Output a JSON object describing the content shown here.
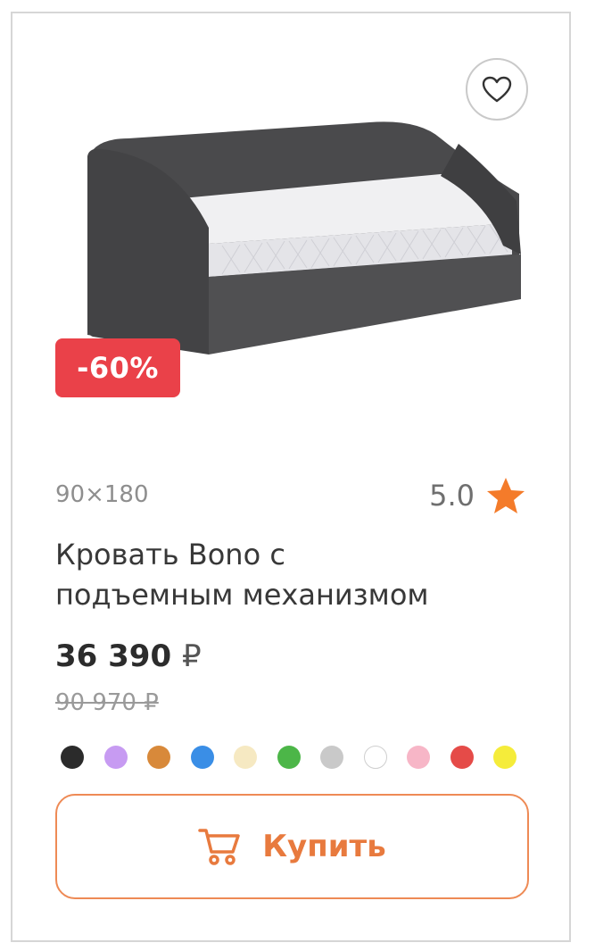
{
  "product": {
    "discount_badge": "-60%",
    "size": "90×180",
    "rating": "5.0",
    "title_line1": "Кровать Bono с",
    "title_line2": "подъемным механизмом",
    "price": "36 390",
    "currency": "₽",
    "old_price": "90 970 ₽",
    "buy_label": "Купить"
  },
  "icons": {
    "favorite": "heart-outline-icon",
    "rating": "star-icon",
    "cart": "cart-icon"
  },
  "theme": {
    "accent": "#ee8a55",
    "badge": "#ea4149",
    "star": "#f47b2a"
  },
  "color_options": [
    "#2b2b2b",
    "#c79bf2",
    "#d8893a",
    "#3a8ee6",
    "#f6e9c2",
    "#4cb648",
    "#c9c9c9",
    "#ffffff",
    "#f7b6c7",
    "#e54b48",
    "#f5ec3a"
  ]
}
